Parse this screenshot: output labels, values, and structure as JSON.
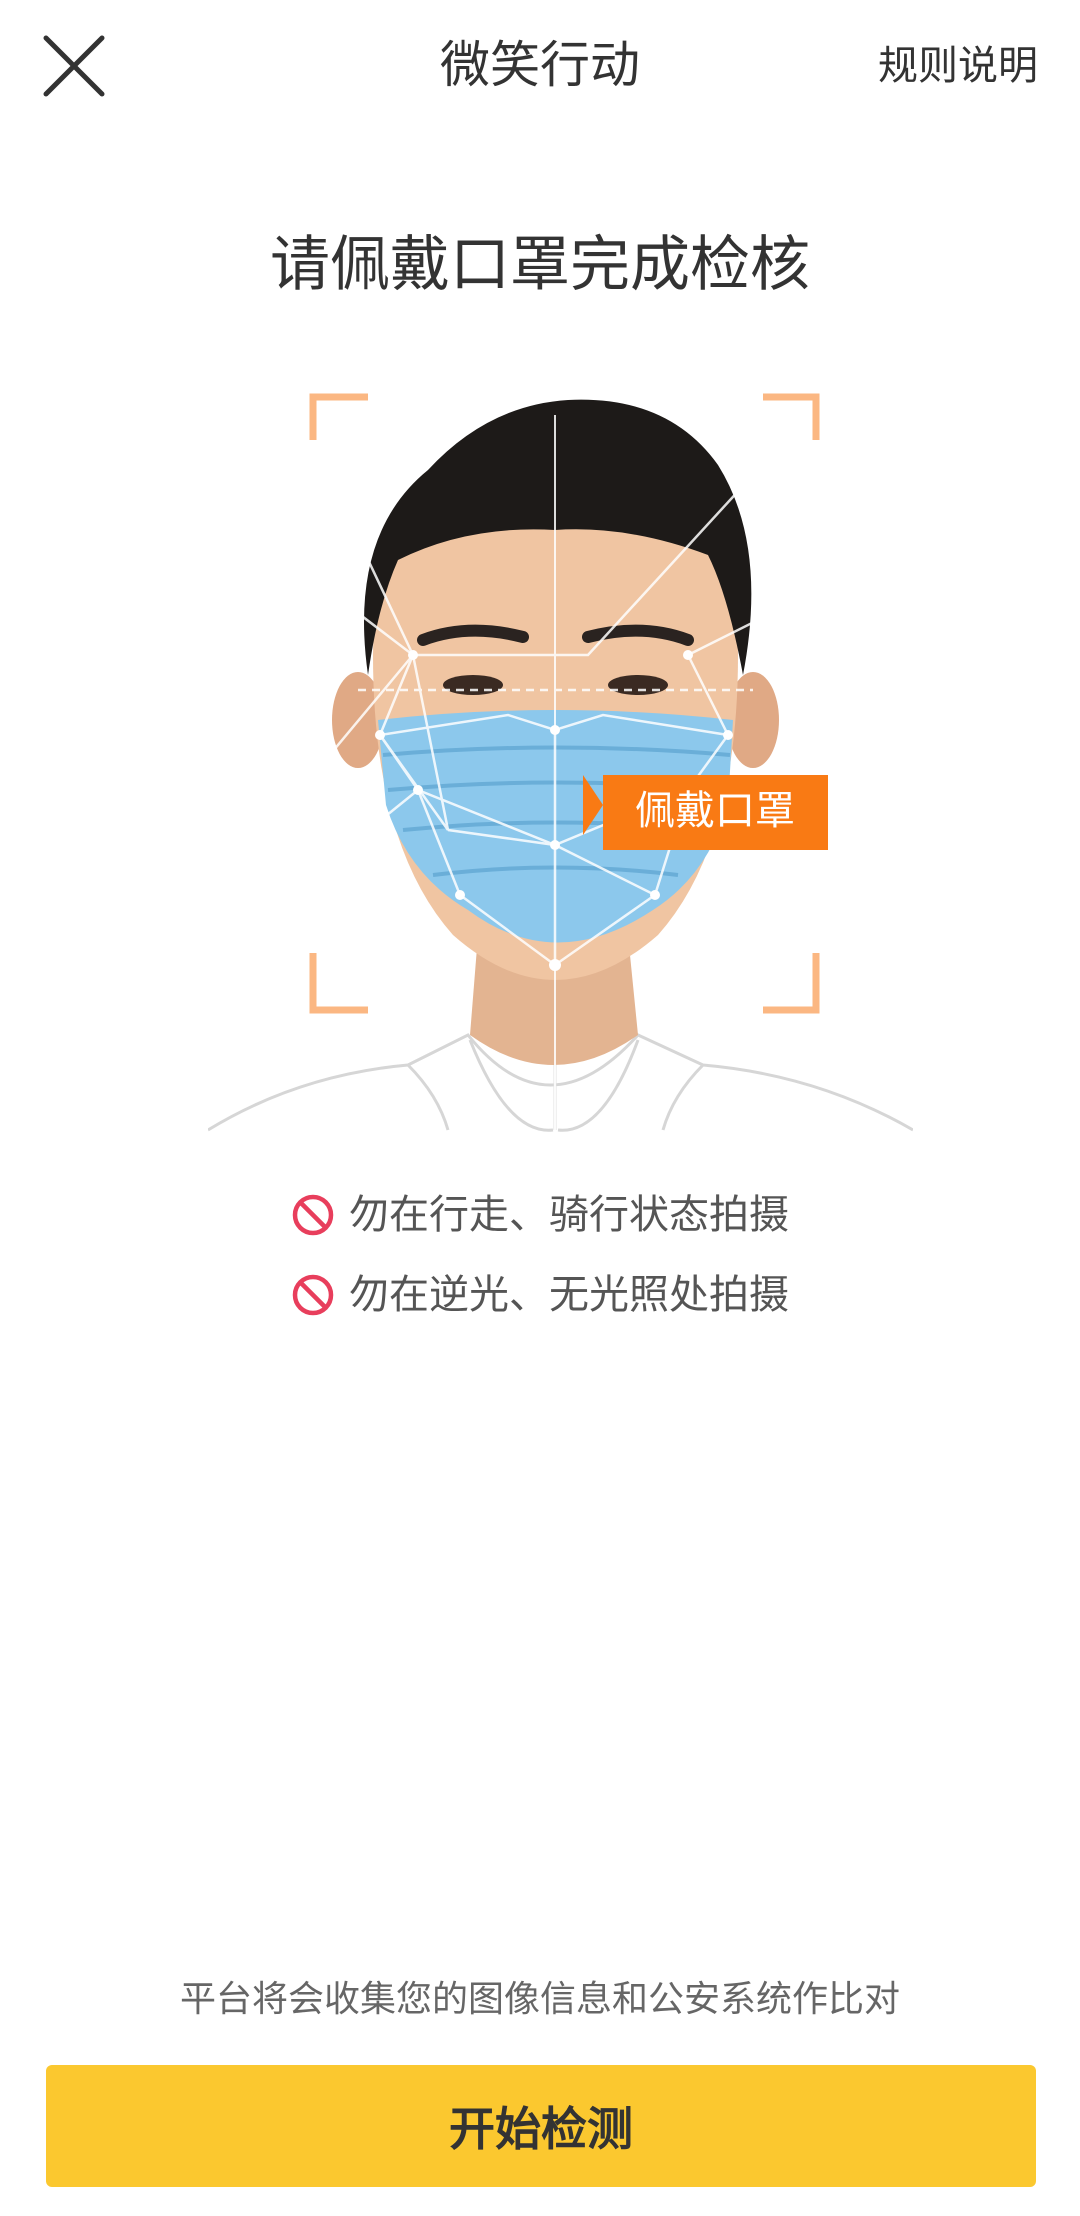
{
  "header": {
    "title": "微笑行动",
    "rules_label": "规则说明",
    "close_icon": "close-icon"
  },
  "main": {
    "title": "请佩戴口罩完成检核",
    "illustration": {
      "tag_label": "佩戴口罩",
      "tag_color": "#f97a14",
      "frame_color": "#fbb782",
      "mask_color": "#8cc8ec"
    },
    "tips": [
      {
        "icon": "prohibited-icon",
        "text": "勿在行走、骑行状态拍摄"
      },
      {
        "icon": "prohibited-icon",
        "text": "勿在逆光、无光照处拍摄"
      }
    ]
  },
  "footer": {
    "privacy_note": "平台将会收集您的图像信息和公安系统作比对",
    "start_button": "开始检测",
    "button_color": "#fbc82f"
  }
}
